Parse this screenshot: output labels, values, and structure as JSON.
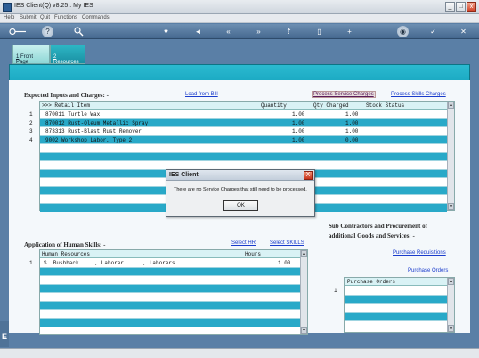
{
  "window": {
    "title": "IES Client(Q) v8.25 : My IES",
    "controls": [
      "_",
      "□",
      "x"
    ]
  },
  "menu": [
    "Help",
    "Submit",
    "Quit",
    "Functions",
    "Commands"
  ],
  "toolbar": {
    "icons": [
      "key-icon",
      "help-icon",
      "search-icon",
      "heart-icon",
      "back-icon",
      "forward-icon",
      "refresh-icon",
      "document-icon",
      "new-icon",
      "save-icon",
      "check-icon",
      "close-icon"
    ]
  },
  "tabs": [
    {
      "num": "1",
      "label": " Front Page"
    },
    {
      "num": "2",
      "label": " Resources"
    }
  ],
  "inputs_section": {
    "title": "Expected Inputs and Charges: -",
    "load_link": "Load from Bill",
    "process_service_link": "Process Service Charges",
    "process_skills_link": "Process Skills Charges",
    "columns": [
      ">>> Retail Item",
      "Quantity",
      "Qty Charged",
      "Stock Status"
    ],
    "rows": [
      {
        "num": "1",
        "item": "870011 Turtle Wax",
        "qty": "1.00",
        "charged": "1.00",
        "status": ""
      },
      {
        "num": "2",
        "item": "870012 Rust-Oleum Metallic Spray",
        "qty": "1.00",
        "charged": "1.00",
        "status": ""
      },
      {
        "num": "3",
        "item": "873313 Rust-Blast Rust Remover",
        "qty": "1.00",
        "charged": "1.00",
        "status": ""
      },
      {
        "num": "4",
        "item": "9002 Workshop Labor, Type 2",
        "qty": "1.00",
        "charged": "0.00",
        "status": ""
      }
    ]
  },
  "skills_section": {
    "title": "Application of Human Skills: -",
    "select_hr": "Select HR",
    "select_skills": "Select SKILLS",
    "columns": [
      "Human Resources",
      "Hours"
    ],
    "rows": [
      {
        "num": "1",
        "resource": "S. Bushback     , Laborer      , Laborers",
        "hours": "1.00"
      }
    ]
  },
  "subcontractors_section": {
    "title_line1": "Sub Contractors and Procurement of",
    "title_line2": "additional Goods and Services: -",
    "purchase_requisitions": "Purchase Requisitions",
    "purchase_orders_link": "Purchase Orders",
    "column": "Purchase Orders",
    "rownum": "1"
  },
  "dialog": {
    "title": "IES Client",
    "message": "There are no Service Charges that still need to be processed.",
    "ok": "OK",
    "close": "X"
  }
}
